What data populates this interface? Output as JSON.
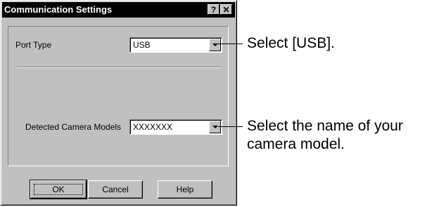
{
  "dialog": {
    "title": "Communication Settings",
    "help_glyph": "?",
    "close_glyph": "✕",
    "port_type_label": "Port Type",
    "port_type_value": "USB",
    "camera_models_label": "Detected Camera Models",
    "camera_models_value": "XXXXXXX",
    "ok_label": "OK",
    "cancel_label": "Cancel",
    "help_label": "Help"
  },
  "callouts": {
    "port": "Select [USB].",
    "model_line1": "Select the name of your",
    "model_line2": "camera model."
  }
}
